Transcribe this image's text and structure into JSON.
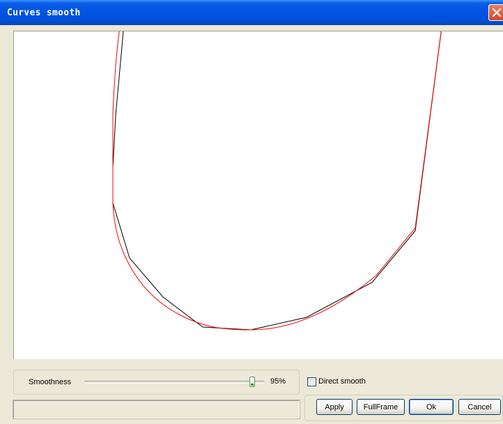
{
  "window": {
    "title": "Curves smooth"
  },
  "controls": {
    "smoothness_label": "Smoothness",
    "smoothness_value": 95,
    "smoothness_display": "95%",
    "direct_smooth_label": "Direct smooth",
    "direct_smooth_checked": false,
    "status_text": ""
  },
  "buttons": {
    "apply": "Apply",
    "fullframe": "FullFrame",
    "ok": "Ok",
    "cancel": "Cancel"
  },
  "colors": {
    "original_curve": "#000000",
    "smoothed_curve": "#ff0000",
    "titlebar": "#0054e3",
    "dialog_bg": "#ece9d8"
  },
  "icons": {
    "close": "close-icon"
  }
}
